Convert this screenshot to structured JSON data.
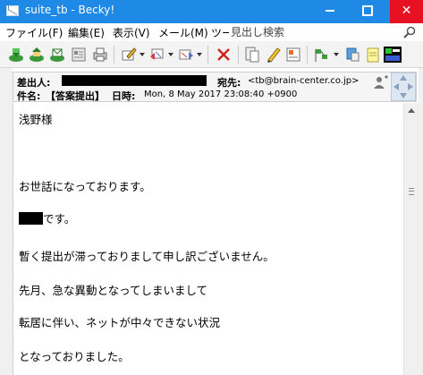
{
  "window": {
    "title": "suite_tb - Becky!",
    "colors": {
      "titlebar": "#1f8ae6",
      "close": "#e81123"
    }
  },
  "menu": {
    "items": [
      "ファイル(F)",
      "編集(E)",
      "表示(V)",
      "メール(M)",
      "ツー"
    ],
    "search_placeholder": "見出し検索",
    "search_value": ""
  },
  "toolbar": {
    "icons": [
      "receive-mail-icon",
      "send-mail-icon",
      "send-receive-icon",
      "address-book-icon",
      "print-icon",
      "compose-icon",
      "reply-icon",
      "forward-icon",
      "delete-icon",
      "filter-icon",
      "edit-icon",
      "properties-icon",
      "flag-icon",
      "memo-icon",
      "note-icon",
      "folder-view-icon"
    ]
  },
  "header": {
    "from_label": "差出人:",
    "to_label": "宛先:",
    "to_value": "<tb@brain-center.co.jp>",
    "subject_label": "件名:",
    "subject_value": "【答案提出】",
    "date_label": "日時:",
    "date_value": "Mon, 8 May 2017 23:08:40 +0900"
  },
  "body": {
    "lines": [
      "浅野様",
      "",
      "",
      "お世話になっております。",
      "",
      "です。",
      "",
      "暫く提出が滞っておりまして申し訳ございません。",
      "",
      "先月、急な異動となってしまいまして",
      "",
      "転居に伴い、ネットが中々できない状況",
      "",
      "となっておりました。"
    ]
  }
}
